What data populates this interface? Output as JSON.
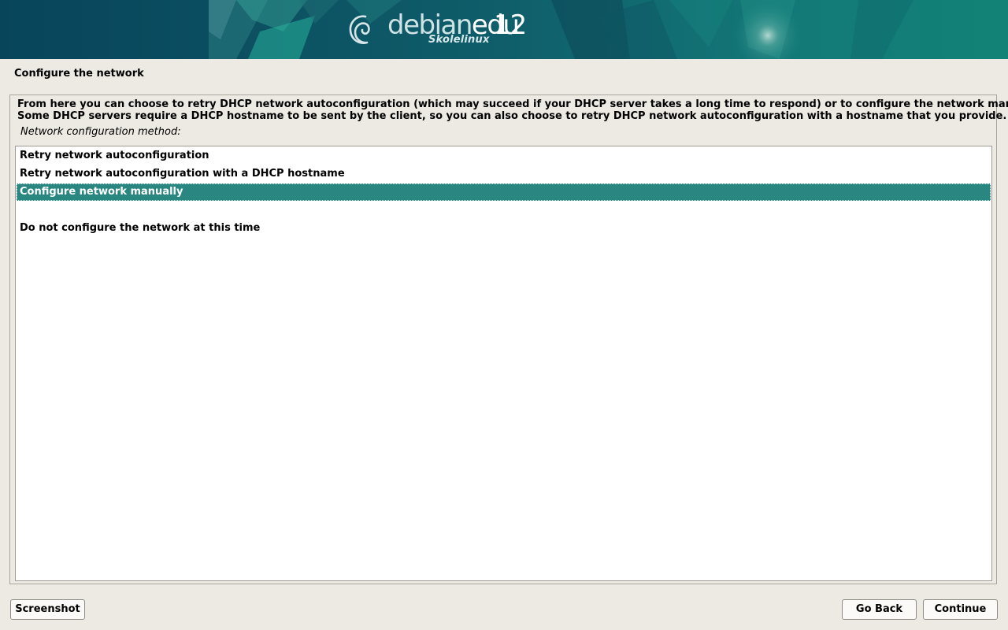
{
  "banner": {
    "logo_debian": "debian",
    "logo_edu": "edu",
    "logo_version": "12",
    "logo_subtitle": "Skolelinux"
  },
  "page": {
    "title": "Configure the network",
    "description_line1": "From here you can choose to retry DHCP network autoconfiguration (which may succeed if your DHCP server takes a long time to respond) or to configure the network manually.",
    "description_line2": "Some DHCP servers require a DHCP hostname to be sent by the client, so you can also choose to retry DHCP network autoconfiguration with a hostname that you provide.",
    "field_label": "Network configuration method:"
  },
  "options": [
    {
      "label": "Retry network autoconfiguration",
      "selected": false
    },
    {
      "label": "Retry network autoconfiguration with a DHCP hostname",
      "selected": false
    },
    {
      "label": "Configure network manually",
      "selected": true
    },
    {
      "label": "",
      "selected": false
    },
    {
      "label": "Do not configure the network at this time",
      "selected": false
    }
  ],
  "buttons": {
    "screenshot": "Screenshot",
    "go_back": "Go Back",
    "continue": "Continue"
  },
  "colors": {
    "banner": "#0c4a5c",
    "selection": "#2a8680",
    "background": "#edeae3"
  }
}
